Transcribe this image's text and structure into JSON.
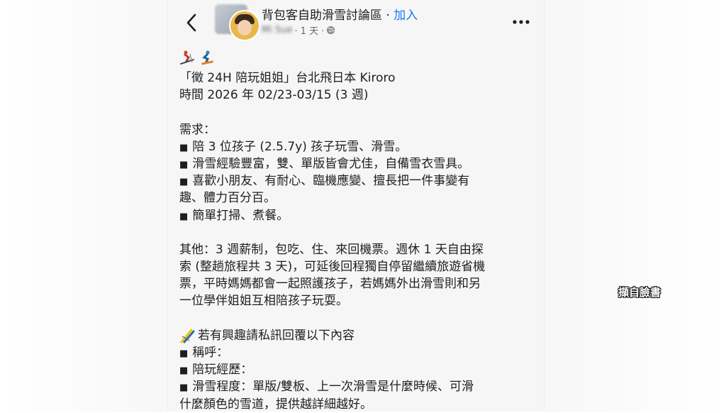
{
  "header": {
    "group_name": "背包客自助滑雪討論區",
    "separator": " · ",
    "join_label": "加入",
    "author": "Mi Sue",
    "time": " · 1 天 · ",
    "back_icon": "chevron-left-icon",
    "privacy_icon": "globe-icon",
    "more_icon": "more-horizontal-icon"
  },
  "post": {
    "leading_emojis": [
      "skier-emoji",
      "snowboarder-emoji"
    ],
    "title_line1": "「徵 24H 陪玩姐姐」台北飛日本 Kiroro",
    "title_line2": "時間 2026 年 02/23-03/15 (3 週)",
    "needs_heading": "需求：",
    "bullet_char": "■",
    "needs": [
      "陪 3 位孩子 (2.5.7y) 孩子玩雪、滑雪。",
      "滑雪經驗豐富，雙、單版皆會尤佳，自備雪衣雪具。",
      "喜歡小朋友、有耐心、臨機應變、擅長把一件事變有",
      "趣、體力百分百。",
      "簡單打掃、煮餐。"
    ],
    "other_lines": [
      "其他：3 週薪制，包吃、住、來回機票。週休 1 天自由探",
      "索 (整趟旅程共 3 天)，可延後回程獨自停留繼續旅遊省機",
      "票，平時媽媽都會一起照護孩子，若媽媽外出滑雪則和另",
      "一位學伴姐姐互相陪孩子玩耍。"
    ],
    "interest_emoji": "skis-emoji",
    "interest_line": "若有興趣請私訊回覆以下內容",
    "interest_items": [
      "稱呼：",
      "陪玩經歷：",
      "滑雪程度：單版/雙板、上一次滑雪是什麼時候、可滑"
    ],
    "interest_continuation": "什麼顏色的雪道，提供越詳細越好。"
  },
  "watermark": "擷自臉書",
  "colors": {
    "link": "#1877f2",
    "text": "#1c1e21",
    "meta": "#65676b",
    "panel": "#f6f6f7"
  }
}
